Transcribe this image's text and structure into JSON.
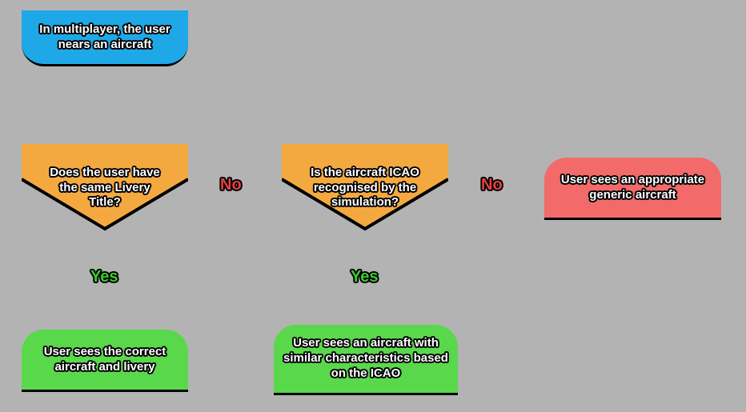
{
  "nodes": {
    "start": "In multiplayer, the user nears an aircraft",
    "decision1": "Does the user have the same Livery Title?",
    "decision2": "Is the aircraft ICAO recognised by the simulation?",
    "outcome_correct": "User sees the correct aircraft and livery",
    "outcome_similar": "User sees an aircraft with similar characteristics based on the ICAO",
    "outcome_generic": "User sees an appropriate generic aircraft"
  },
  "edges": {
    "yes": "Yes",
    "no": "No"
  },
  "colors": {
    "start": "#1ea8e8",
    "decision": "#f4a940",
    "success": "#5ad84b",
    "fallback": "#f26a6a",
    "yes": "#39cc2f",
    "no": "#e83f3f"
  },
  "chart_data": {
    "type": "flowchart",
    "nodes": [
      {
        "id": "start",
        "kind": "start",
        "text": "In multiplayer, the user nears an aircraft"
      },
      {
        "id": "d1",
        "kind": "decision",
        "text": "Does the user have the same Livery Title?"
      },
      {
        "id": "d2",
        "kind": "decision",
        "text": "Is the aircraft ICAO recognised by the simulation?"
      },
      {
        "id": "o1",
        "kind": "terminal",
        "text": "User sees the correct aircraft and livery"
      },
      {
        "id": "o2",
        "kind": "terminal",
        "text": "User sees an aircraft with similar characteristics based on the ICAO"
      },
      {
        "id": "o3",
        "kind": "terminal",
        "text": "User sees an appropriate generic aircraft"
      }
    ],
    "edges": [
      {
        "from": "start",
        "to": "d1"
      },
      {
        "from": "d1",
        "to": "o1",
        "label": "Yes"
      },
      {
        "from": "d1",
        "to": "d2",
        "label": "No"
      },
      {
        "from": "d2",
        "to": "o2",
        "label": "Yes"
      },
      {
        "from": "d2",
        "to": "o3",
        "label": "No"
      }
    ]
  }
}
